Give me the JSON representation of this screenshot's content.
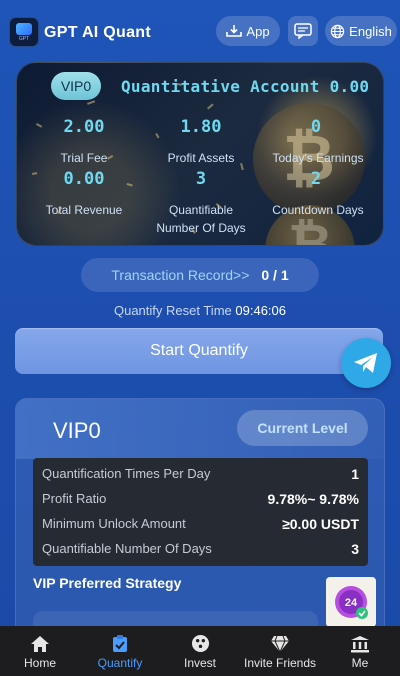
{
  "header": {
    "brand": "GPT AI Quant",
    "logo_text": "GPT",
    "app_label": "App",
    "language_label": "English"
  },
  "quant_card": {
    "vip_badge": "VIP0",
    "title": "Quantitative Account 0.00",
    "stats": [
      {
        "value": "2.00",
        "label": "Trial Fee"
      },
      {
        "value": "1.80",
        "label": "Profit Assets"
      },
      {
        "value": "0",
        "label": "Today's Earnings"
      },
      {
        "value": "0.00",
        "label": "Total Revenue"
      },
      {
        "value": "3",
        "label": "Quantifiable Number Of Days"
      },
      {
        "value": "2",
        "label": "Countdown Days"
      }
    ]
  },
  "transaction": {
    "label": "Transaction Record>>",
    "count": "0 / 1"
  },
  "reset": {
    "label": "Quantify Reset Time",
    "time": "09:46:06"
  },
  "start_button": "Start Quantify",
  "vip_panel": {
    "level": "VIP0",
    "current_level_label": "Current Level",
    "rows": [
      {
        "key": "Quantification Times Per Day",
        "value": "1"
      },
      {
        "key": "Profit Ratio",
        "value": "9.78%~ 9.78%"
      },
      {
        "key": "Minimum Unlock Amount",
        "value": "≥0.00 USDT"
      },
      {
        "key": "Quantifiable Number Of Days",
        "value": "3"
      }
    ],
    "strategy_title": "VIP Preferred Strategy",
    "badge_text": "24"
  },
  "bottom_nav": [
    {
      "label": "Home",
      "icon": "home-icon",
      "active": false
    },
    {
      "label": "Quantify",
      "icon": "clipboard-icon",
      "active": true
    },
    {
      "label": "Invest",
      "icon": "invest-icon",
      "active": false
    },
    {
      "label": "Invite Friends",
      "icon": "diamond-icon",
      "active": false
    },
    {
      "label": "Me",
      "icon": "bank-icon",
      "active": false
    }
  ],
  "colors": {
    "background": "#1f55b8",
    "accent_cyan": "#6fd9f0",
    "active_nav": "#4a9cff",
    "telegram": "#2ea8e6"
  }
}
